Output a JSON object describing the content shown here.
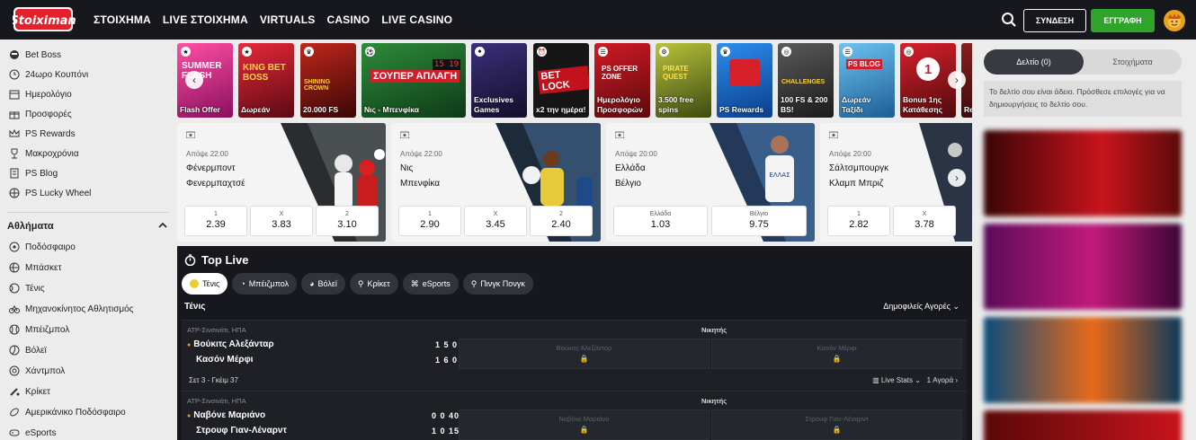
{
  "header": {
    "logo_text": "Stoiximan",
    "nav": [
      "ΣΤΟΙΧΗΜΑ",
      "LIVE ΣΤΟΙΧΗΜΑ",
      "VIRTUALS",
      "CASINO",
      "LIVE CASINO"
    ],
    "login_label": "ΣΥΝΔΕΣΗ",
    "register_label": "ΕΓΓΡΑΦΗ"
  },
  "sidebar": {
    "items": [
      {
        "label": "Bet Boss",
        "icon": "boss-icon"
      },
      {
        "label": "24ωρο Κουπόνι",
        "icon": "coupon-icon"
      },
      {
        "label": "Ημερολόγιο",
        "icon": "calendar-icon"
      },
      {
        "label": "Προσφορές",
        "icon": "gift-icon"
      },
      {
        "label": "PS Rewards",
        "icon": "crown-icon"
      },
      {
        "label": "Μακροχρόνια",
        "icon": "trophy-icon"
      },
      {
        "label": "PS Blog",
        "icon": "blog-icon"
      },
      {
        "label": "PS Lucky Wheel",
        "icon": "wheel-icon"
      }
    ],
    "sports_header": "Αθλήματα",
    "sports": [
      {
        "label": "Ποδόσφαιρο",
        "icon": "soccer-icon"
      },
      {
        "label": "Μπάσκετ",
        "icon": "basketball-icon"
      },
      {
        "label": "Τένις",
        "icon": "tennis-icon"
      },
      {
        "label": "Μηχανοκίνητος Αθλητισμός",
        "icon": "motorsport-icon"
      },
      {
        "label": "Μπέιζμπολ",
        "icon": "baseball-icon"
      },
      {
        "label": "Βόλεϊ",
        "icon": "volleyball-icon"
      },
      {
        "label": "Χάντμπολ",
        "icon": "handball-icon"
      },
      {
        "label": "Κρίκετ",
        "icon": "cricket-icon"
      },
      {
        "label": "Αμερικάνικο Ποδόσφαιρο",
        "icon": "football-icon"
      },
      {
        "label": "eSports",
        "icon": "esports-icon"
      }
    ]
  },
  "promos": [
    {
      "label": "Flash Offer",
      "art": "SUMMER FLASH",
      "color": "#c0177a"
    },
    {
      "label": "Δωρεάν",
      "art": "KING BET BOSS",
      "color": "#b01420"
    },
    {
      "label": "20.000 FS",
      "art": "SHINING CROWN",
      "color": "#7a0f0f"
    },
    {
      "label": "Νις - Μπενφίκα",
      "art": "ΣΟΥΠΕΡ ΑΠΛΑΓΗ",
      "color": "#1f6a2d"
    },
    {
      "label": "Exclusives Games",
      "art": "",
      "color": "#2a2458"
    },
    {
      "label": "x2 την ημέρα!",
      "art": "BET LOCK",
      "color": "#1b1b1b"
    },
    {
      "label": "Ημερολόγιο Προσφορών",
      "art": "PS OFFER ZONE",
      "color": "#b3121b"
    },
    {
      "label": "3.500 free spins",
      "art": "PIRATE QUEST",
      "color": "#7a8a1a"
    },
    {
      "label": "PS Rewards",
      "art": "",
      "color": "#1b6fc4"
    },
    {
      "label": "100 FS & 200 BS!",
      "art": "CHALLENGES",
      "color": "#3d3d3d"
    },
    {
      "label": "Δωρεάν Ταξίδι",
      "art": "PS BLOG",
      "color": "#2a85c9"
    },
    {
      "label": "Bonus 1ης Κατάθεσης",
      "art": "1",
      "color": "#a8141c"
    },
    {
      "label": "Re",
      "art": "",
      "color": "#6a1a1a"
    }
  ],
  "events": [
    {
      "time": "Απόψε 22:00",
      "team1": "Φένερμποντ",
      "team2": "Φενερμπαχτσέ",
      "odds": [
        {
          "label": "1",
          "value": "2.39"
        },
        {
          "label": "X",
          "value": "3.83"
        },
        {
          "label": "2",
          "value": "3.10"
        }
      ]
    },
    {
      "time": "Απόψε 22:00",
      "team1": "Νις",
      "team2": "Μπενφίκα",
      "odds": [
        {
          "label": "1",
          "value": "2.90"
        },
        {
          "label": "X",
          "value": "3.45"
        },
        {
          "label": "2",
          "value": "2.40"
        }
      ]
    },
    {
      "time": "Απόψε 20:00",
      "team1": "Ελλάδα",
      "team2": "Βέλγιο",
      "odds": [
        {
          "label": "Ελλάδα",
          "value": "1.03"
        },
        {
          "label": "Βέλγιο",
          "value": "9.75"
        }
      ]
    },
    {
      "time": "Απόψε 20:00",
      "team1": "Σάλτσμπουργκ",
      "team2": "Κλαμπ Μπριζ",
      "odds": [
        {
          "label": "1",
          "value": "2.82"
        },
        {
          "label": "X",
          "value": "3.78"
        }
      ]
    }
  ],
  "top_live": {
    "title": "Top Live",
    "chips": [
      {
        "label": "Τένις",
        "icon": "tennis-icon",
        "active": true
      },
      {
        "label": "Μπέιζμπολ",
        "icon": "baseball-icon",
        "active": false
      },
      {
        "label": "Βόλεϊ",
        "icon": "volleyball-icon",
        "active": false
      },
      {
        "label": "Κρίκετ",
        "icon": "cricket-icon",
        "active": false
      },
      {
        "label": "eSports",
        "icon": "gamepad-icon",
        "active": false
      },
      {
        "label": "Πινγκ Πονγκ",
        "icon": "pingpong-icon",
        "active": false
      }
    ],
    "sport_title": "Τένις",
    "popular_markets": "Δημοφιλείς Αγορές",
    "matches": [
      {
        "league": "ATP-Σινσινάτι, ΗΠΑ",
        "market": "Νικητής",
        "p1": "Βούκιτς Αλεξάνταρ",
        "p2": "Κασόν Μέρφι",
        "s1": "1 5 0",
        "s2": "1 6 0",
        "o1": "Βούκιτς Αλεξάνταρ",
        "o2": "Κασόν Μέρφι",
        "status": "Σετ 3 - Γκέιμ 37",
        "live_stats": "Live Stats",
        "markets": "1 Αγορά"
      },
      {
        "league": "ATP-Σινσινάτι, ΗΠΑ",
        "market": "Νικητής",
        "p1": "Ναβόνε Μαριάνο",
        "p2": "Στρουφ Γιαν-Λέναρντ",
        "s1": "0 0 40",
        "s2": "1 0 15",
        "o1": "Ναβόνε Μαριάνο",
        "o2": "Στρουφ Γιαν-Λέναρντ"
      }
    ]
  },
  "betslip": {
    "tab_slip": "Δελτίο (0)",
    "tab_bets": "Στοιχήματα",
    "empty_text": "Το δελτίο σου είναι άδειο. Πρόσθεσε επιλογές για να δημιουργήσεις το δελτίο σου."
  },
  "colors": {
    "topbar": "#16181d",
    "register_green": "#2ea42a",
    "brand_red": "#e3202b",
    "live_bg": "#16181d"
  }
}
